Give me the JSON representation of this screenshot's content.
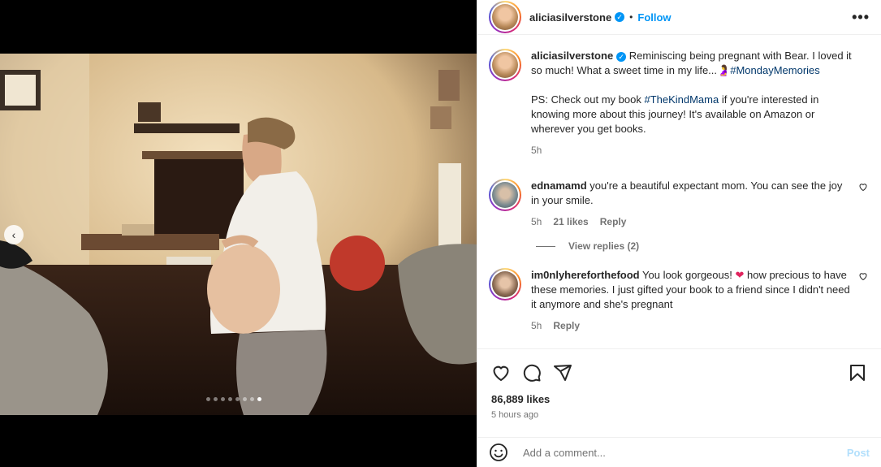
{
  "post": {
    "author": "aliciasilverstone",
    "follow_label": "Follow",
    "separator": "•",
    "more_label": "•••",
    "caption": {
      "author": "aliciasilverstone",
      "text_1": "Reminiscing being pregnant with Bear. I loved it so much! What a sweet time in my life...",
      "hashtag_1": "#MondayMemories",
      "text_2": "PS: Check out my book ",
      "hashtag_2": "#TheKindMama",
      "text_3": " if you're interested in knowing more about this journey! It's available on Amazon or wherever you get books.",
      "time": "5h"
    },
    "comments": [
      {
        "user": "ednamamd",
        "text": "you're a beautiful expectant mom. You can see the joy in your smile.",
        "time": "5h",
        "likes": "21 likes",
        "reply": "Reply"
      },
      {
        "user": "im0nlyhereforthefood",
        "text_1": "You look gorgeous! ",
        "text_2": " how precious to have these memories. I just gifted your book to a friend since I didn't need it anymore and she's pregnant",
        "time": "5h",
        "reply": "Reply"
      }
    ],
    "view_replies": "View replies (2)",
    "likes": "86,889 likes",
    "posted": "5 hours ago",
    "add_comment_placeholder": "Add a comment...",
    "post_label": "Post",
    "carousel": {
      "count": 8,
      "active_index": 7
    }
  },
  "colors": {
    "link": "#0095f6",
    "hashtag": "#00376b",
    "muted": "#737373",
    "post_disabled": "#b2dffc"
  }
}
